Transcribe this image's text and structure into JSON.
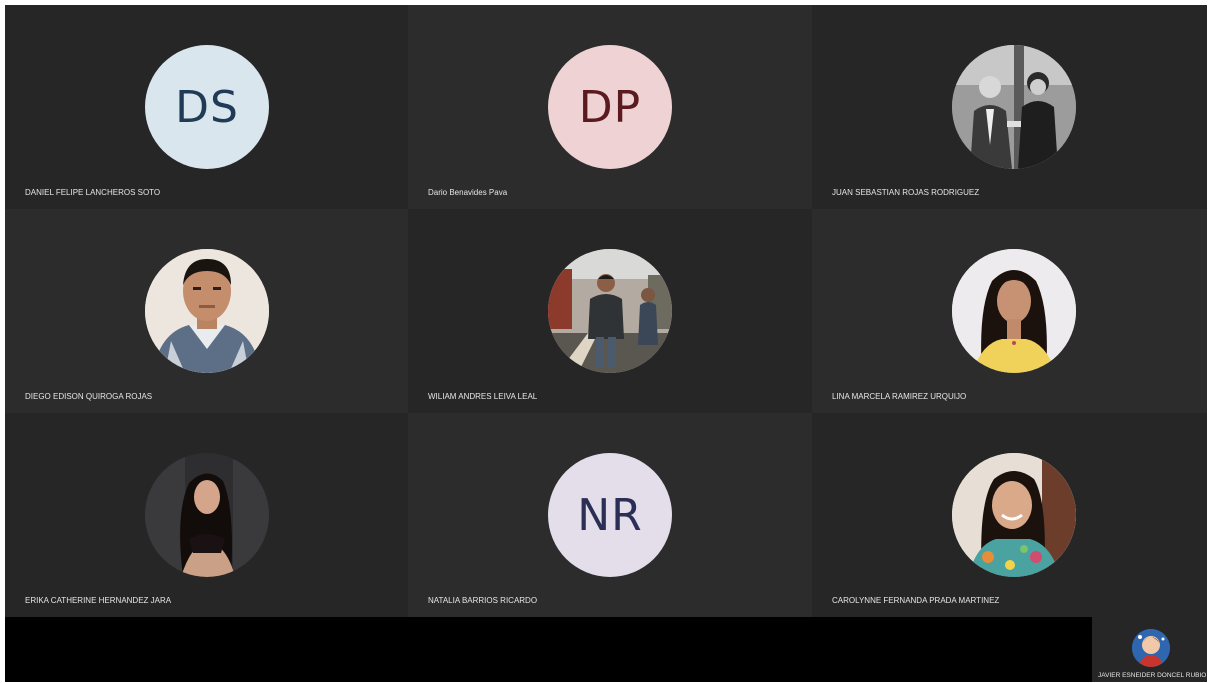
{
  "participants": [
    {
      "name": "DANIEL FELIPE LANCHEROS SOTO",
      "initials": "DS",
      "avatar_type": "initials",
      "avatar_bg": "#d9e6ee",
      "initials_color": "#1f3b55"
    },
    {
      "name": "Dario Benavides Pava",
      "initials": "DP",
      "avatar_type": "initials",
      "avatar_bg": "#efd3d4",
      "initials_color": "#5a1a1f"
    },
    {
      "name": "JUAN SEBASTIAN ROJAS RODRIGUEZ",
      "avatar_type": "photo",
      "photo": "black-and-white-two-men-handshake-photo"
    },
    {
      "name": "DIEGO EDISON QUIROGA ROJAS",
      "avatar_type": "photo",
      "photo": "man-plaid-shirt-portrait-photo"
    },
    {
      "name": "WILIAM ANDRES LEIVA LEAL",
      "avatar_type": "photo",
      "photo": "man-on-street-photo"
    },
    {
      "name": "LINA MARCELA RAMIREZ URQUIJO",
      "avatar_type": "photo",
      "photo": "woman-yellow-top-portrait-photo"
    },
    {
      "name": "ERIKA CATHERINE HERNANDEZ JARA",
      "avatar_type": "photo",
      "photo": "woman-dark-background-portrait-photo"
    },
    {
      "name": "NATALIA BARRIOS RICARDO",
      "initials": "NR",
      "avatar_type": "initials",
      "avatar_bg": "#e3deea",
      "initials_color": "#2c2f55"
    },
    {
      "name": "CAROLYNNE FERNANDA PRADA MARTINEZ",
      "avatar_type": "photo",
      "photo": "woman-smiling-floral-shirt-photo"
    }
  ],
  "self_view": {
    "name": "JAVIER ESNEIDER DONCEL RUBIO",
    "avatar_type": "photo",
    "photo": "man-cartoon-avatar-photo"
  },
  "colors": {
    "tile_bg": "#262626",
    "bottom_bar": "#000000",
    "name_text": "#e6e6e6"
  }
}
